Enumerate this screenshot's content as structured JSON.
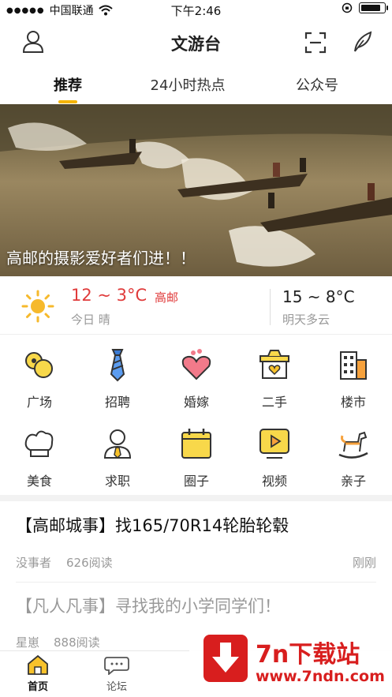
{
  "status_bar": {
    "carrier": "中国联通",
    "time": "下午2:46",
    "battery_level": 0.9
  },
  "header": {
    "title": "文游台"
  },
  "tabs": [
    {
      "label": "推荐",
      "active": true
    },
    {
      "label": "24小时热点",
      "active": false
    },
    {
      "label": "公众号",
      "active": false
    }
  ],
  "banner": {
    "caption": "高邮的摄影爱好者们进！！"
  },
  "weather": {
    "today_range": "12 ~ 3°C",
    "city": "高邮",
    "today_label": "今日 晴",
    "tomorrow_range": "15 ~ 8°C",
    "tomorrow_label": "明天多云"
  },
  "grid": [
    {
      "label": "广场",
      "icon": "plaza-icon"
    },
    {
      "label": "招聘",
      "icon": "tie-icon"
    },
    {
      "label": "婚嫁",
      "icon": "heart-icon"
    },
    {
      "label": "二手",
      "icon": "secondhand-box-icon"
    },
    {
      "label": "楼市",
      "icon": "building-icon"
    },
    {
      "label": "美食",
      "icon": "chef-hat-icon"
    },
    {
      "label": "求职",
      "icon": "job-seeker-icon"
    },
    {
      "label": "圈子",
      "icon": "calendar-icon"
    },
    {
      "label": "视频",
      "icon": "play-video-icon"
    },
    {
      "label": "亲子",
      "icon": "rocking-horse-icon"
    }
  ],
  "news": [
    {
      "title": "【高邮城事】找165/70R14轮胎轮毂",
      "author": "没事者",
      "reads": "626阅读",
      "time": "刚刚"
    },
    {
      "title": "【凡人凡事】寻找我的小学同学们！",
      "author": "星崽",
      "reads": "888阅读"
    }
  ],
  "bottom_nav": [
    {
      "label": "首页",
      "icon": "home-icon",
      "active": true
    },
    {
      "label": "论坛",
      "icon": "chat-bubble-icon",
      "active": false
    }
  ],
  "ad": {
    "brand": "7n下载站",
    "url": "www.7ndn.com"
  },
  "colors": {
    "accent": "#f5b400",
    "temperature_red": "#e03b3b",
    "ad_red": "#d81e1e"
  }
}
